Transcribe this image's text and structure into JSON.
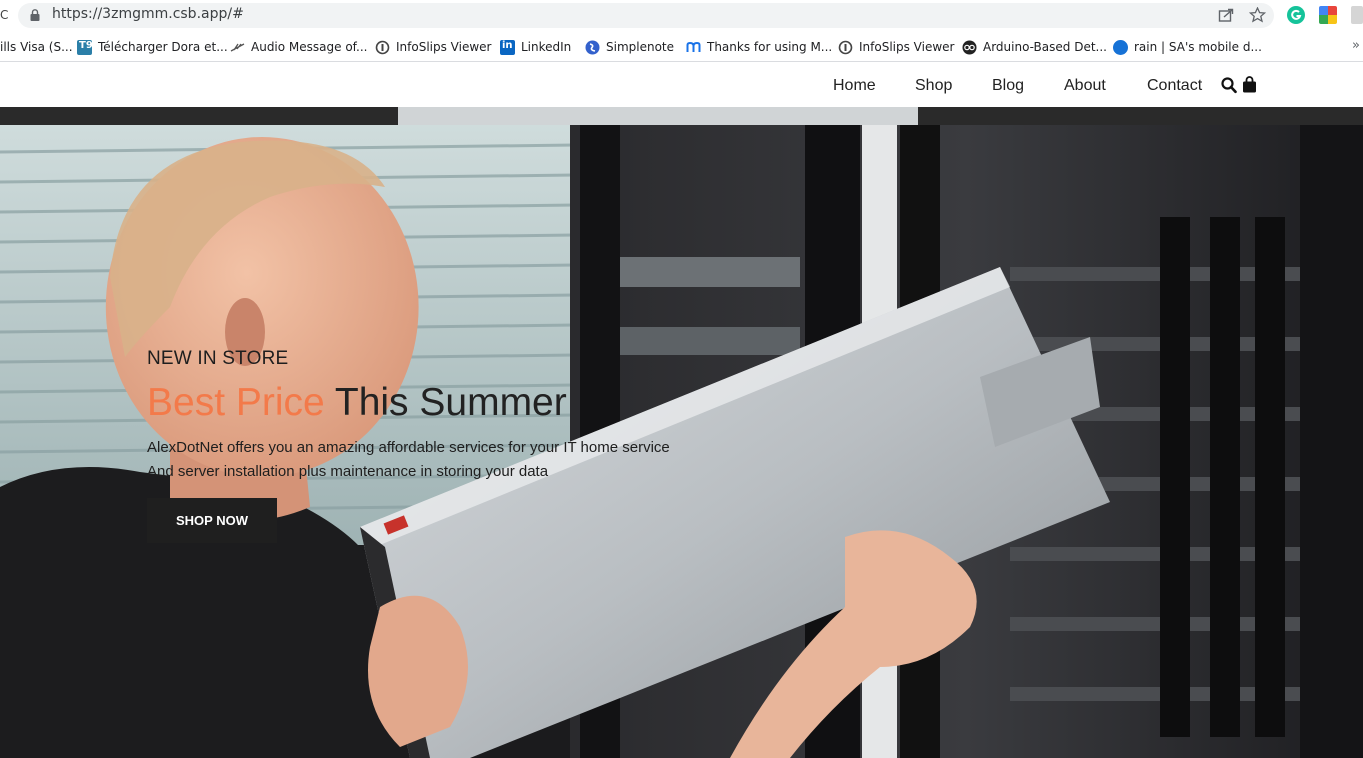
{
  "browser": {
    "url": "https://3zmgmm.csb.app/#",
    "bookmarks": [
      {
        "label": "ills Visa (S...",
        "icon": "partial-icon"
      },
      {
        "label": "Télécharger Dora et...",
        "icon": "t9-icon"
      },
      {
        "label": "Audio Message of...",
        "icon": "feather-icon"
      },
      {
        "label": "InfoSlips Viewer",
        "icon": "infoslips-icon"
      },
      {
        "label": "LinkedIn",
        "icon": "linkedin-icon"
      },
      {
        "label": "Simplenote",
        "icon": "simplenote-icon"
      },
      {
        "label": "Thanks for using M...",
        "icon": "m-icon"
      },
      {
        "label": "InfoSlips Viewer",
        "icon": "infoslips-icon"
      },
      {
        "label": "Arduino-Based Det...",
        "icon": "arduino-icon"
      },
      {
        "label": "rain | SA's mobile d...",
        "icon": "rain-icon"
      }
    ],
    "more": "»"
  },
  "site": {
    "nav": [
      "Home",
      "Shop",
      "Blog",
      "About",
      "Contact"
    ],
    "icons": [
      "search-icon",
      "cart-icon"
    ]
  },
  "hero": {
    "eyebrow": "NEW IN STORE",
    "headline_accent": "Best Price",
    "headline_rest": " This Summer",
    "desc_line1": "AlexDotNet offers you an amazing affordable services for your IT home service",
    "desc_line2": "And server installation plus maintenance in storing your data",
    "button": "SHOP NOW"
  },
  "colors": {
    "accent": "#f37a4a",
    "button_bg": "#1f1f1f"
  }
}
